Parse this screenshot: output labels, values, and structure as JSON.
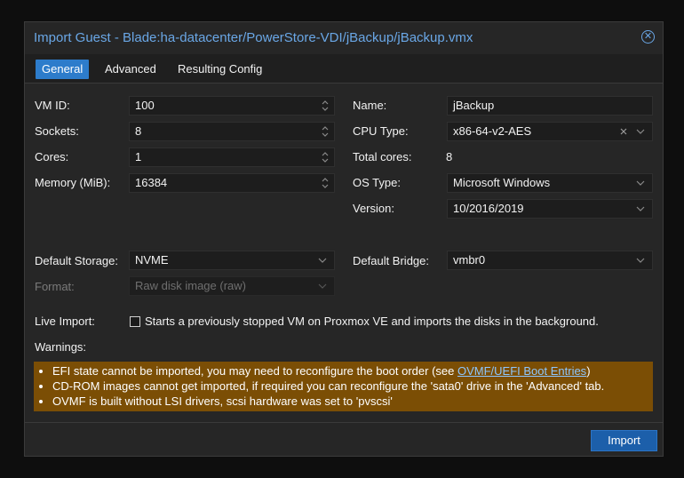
{
  "dialog": {
    "title": "Import Guest - Blade:ha-datacenter/PowerStore-VDI/jBackup/jBackup.vmx",
    "close_glyph": "✕",
    "accent_color": "#6aa7e6"
  },
  "tabs": [
    {
      "label": "General",
      "active": true
    },
    {
      "label": "Advanced",
      "active": false
    },
    {
      "label": "Resulting Config",
      "active": false
    }
  ],
  "general": {
    "vmid": {
      "label": "VM ID:",
      "value": "100"
    },
    "sockets": {
      "label": "Sockets:",
      "value": "8"
    },
    "cores": {
      "label": "Cores:",
      "value": "1"
    },
    "memory": {
      "label": "Memory (MiB):",
      "value": "16384"
    },
    "name": {
      "label": "Name:",
      "value": "jBackup"
    },
    "cpu_type": {
      "label": "CPU Type:",
      "value": "x86-64-v2-AES"
    },
    "total_cores": {
      "label": "Total cores:",
      "value": "8"
    },
    "os_type": {
      "label": "OS Type:",
      "value": "Microsoft Windows"
    },
    "version": {
      "label": "Version:",
      "value": "10/2016/2019"
    },
    "default_storage": {
      "label": "Default Storage:",
      "value": "NVME"
    },
    "default_bridge": {
      "label": "Default Bridge:",
      "value": "vmbr0"
    },
    "format": {
      "label": "Format:",
      "value": "Raw disk image (raw)"
    },
    "live_import": {
      "label": "Live Import:",
      "checked": false,
      "description": "Starts a previously stopped VM on Proxmox VE and imports the disks in the background."
    }
  },
  "warnings": {
    "label": "Warnings:",
    "items": {
      "efi_prefix": "EFI state cannot be imported, you may need to reconfigure the boot order (see ",
      "efi_link": "OVMF/UEFI Boot Entries",
      "efi_suffix": ")",
      "cdrom": "CD-ROM images cannot get imported, if required you can reconfigure the 'sata0' drive in the 'Advanced' tab.",
      "ovmf": "OVMF is built without LSI drivers, scsi hardware was set to 'pvscsi'"
    },
    "bg_color": "#7b4e05"
  },
  "footer": {
    "import_label": "Import"
  }
}
